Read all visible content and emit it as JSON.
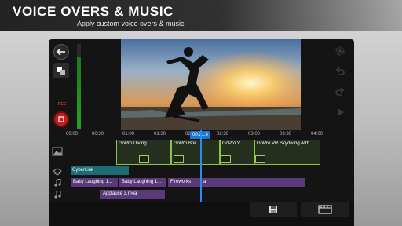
{
  "promo": {
    "headline": "VOICE OVERS & MUSIC",
    "subline": "Apply custom voice overs & music"
  },
  "left_panel": {
    "rec_label": "REC",
    "back_icon": "back-arrow-icon",
    "add_icon": "add-media-icon",
    "record_icon": "record-button-icon"
  },
  "timeline": {
    "ticks": [
      "00:00",
      "00:30",
      "01:00",
      "01:30",
      "02:00",
      "02:30",
      "03:00",
      "03:30",
      "04:00"
    ],
    "current_time": "00:21.4",
    "video_clips": [
      {
        "label": "GoPro Diving"
      },
      {
        "label": "GoPro Bre"
      },
      {
        "label": "GoPro V"
      },
      {
        "label": "GoPro VR  Skydiving with"
      }
    ],
    "overlay_clips": [
      {
        "label": "CyberLink"
      }
    ],
    "audio_track_1": [
      {
        "label": "Baby Laughing 1..."
      },
      {
        "label": "Baby Laughing 1..."
      },
      {
        "label": "Fireworks"
      },
      {
        "label": "a"
      }
    ],
    "audio_track_2": [
      {
        "label": "Applause 3.m4a"
      }
    ]
  },
  "colors": {
    "accent": "#1a78d4",
    "video_clip_border": "#8bc34a",
    "audio_clip": "#5a3a7a",
    "overlay_clip": "#1f6b73",
    "record": "#c21f1f",
    "meter": "#23a323"
  },
  "tools": [
    "settings-gear-icon",
    "undo-icon",
    "redo-icon",
    "play-icon"
  ],
  "bottom_bar": {
    "buttons": [
      "save-project-icon",
      "produce-export-icon"
    ]
  }
}
